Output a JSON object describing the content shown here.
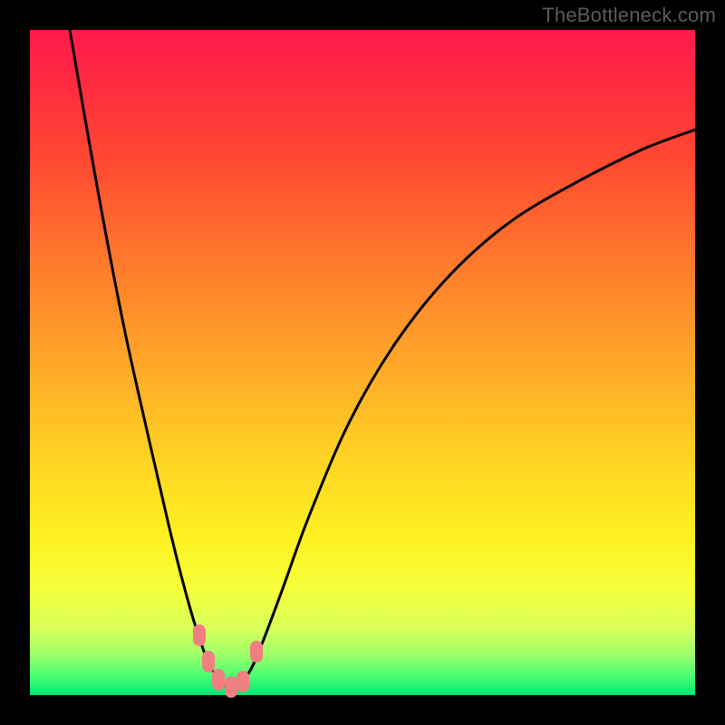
{
  "watermark": "TheBottleneck.com",
  "colors": {
    "frame": "#000000",
    "curve": "#000000",
    "marker": "#f08080"
  },
  "chart_data": {
    "type": "line",
    "title": "",
    "xlabel": "",
    "ylabel": "",
    "xlim": [
      0,
      100
    ],
    "ylim": [
      0,
      100
    ],
    "grid": false,
    "series": [
      {
        "name": "bottleneck-curve",
        "x": [
          6,
          10,
          14,
          18,
          21,
          23,
          25,
          27,
          29,
          30,
          31,
          33,
          35,
          38,
          42,
          48,
          55,
          63,
          72,
          82,
          92,
          100
        ],
        "values": [
          100,
          77,
          56,
          38,
          25,
          17,
          10,
          4.5,
          1.8,
          1.2,
          1.5,
          3.5,
          8,
          16,
          27,
          41,
          53,
          63,
          71,
          77,
          82,
          85
        ]
      }
    ],
    "markers": [
      {
        "x": 25.5,
        "y": 9
      },
      {
        "x": 26.8,
        "y": 5
      },
      {
        "x": 28.3,
        "y": 2.3
      },
      {
        "x": 30.2,
        "y": 1.2
      },
      {
        "x": 32.0,
        "y": 2.0
      },
      {
        "x": 34.0,
        "y": 6.5
      }
    ],
    "annotations": []
  }
}
